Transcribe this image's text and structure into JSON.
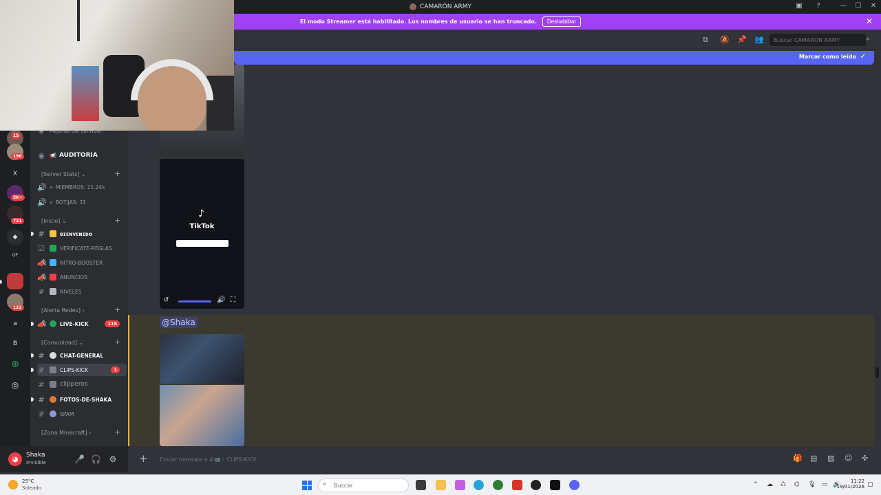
{
  "window": {
    "server_title": "CAMARÓN ARMY",
    "minimize": "—",
    "maximize": "☐",
    "close": "✕"
  },
  "streamer_banner": {
    "text": "El modo Streamer está habilitado. Los nombres de usuario se han truncado.",
    "button_label": "Deshabilitar",
    "close": "✕"
  },
  "header": {
    "search_placeholder": "Buscar CAMARÓN ARMY",
    "mark_read": "Marcar como leído"
  },
  "rail": {
    "badges": [
      "15",
      "196",
      "5K+",
      "721",
      "122"
    ],
    "labels": [
      "X",
      "OF",
      "a",
      "B"
    ]
  },
  "sidebar": {
    "top_item": "Mejoras del servidor",
    "auditoria": "AUDITORIA",
    "categories": {
      "server_stats": "[Server Stats]",
      "inicio": "[Inicio]",
      "alerta_redes": "[Alerta Redes]",
      "comunidad": "[Comunidad]",
      "zona_minecraft": "[Zona Minecraft]"
    },
    "stats": {
      "miembros": "MIEMBROS: 21.24k",
      "botijas": "BOTIJAS: 31"
    },
    "channels": {
      "bienvenido": "ʙɪᴇɴᴠᴇɴɪᴅᴏ",
      "verificate": "VERIFICATE-REGLAS",
      "nitro": "NITRO-BOOSTER",
      "anuncios": "ANUNCIOS",
      "niveles": "NIVELES",
      "live_kick": "LIVE-KICK",
      "live_kick_count": "115",
      "chat_general": "CHAT-GENERAL",
      "clips_kick": "CLIPS-KICK",
      "clips_kick_count": "1",
      "clipperos": "clipperos",
      "fotos": "FOTOS-DE-SHAKA",
      "spam": "SPAM"
    }
  },
  "user": {
    "name": "Shaka",
    "status": "Invisible"
  },
  "messages": {
    "mention": "@Shaka",
    "tiktok_brand": "TikTok"
  },
  "composer": {
    "placeholder": "Enviar mensaje a #📹꒱ CLIPS-KICK"
  },
  "taskbar": {
    "temperature": "25°C",
    "condition": "Soleado",
    "search_placeholder": "Buscar",
    "time": "11:22",
    "date": "19/01/2026"
  },
  "colors": {
    "streamer_banner": "#a041f5",
    "new_messages_bar": "#5865f2",
    "mention_bg": "#3e4270",
    "highlight_bg": "#3c3a2f",
    "highlight_border": "#f0b232",
    "badge": "#f23f43"
  }
}
